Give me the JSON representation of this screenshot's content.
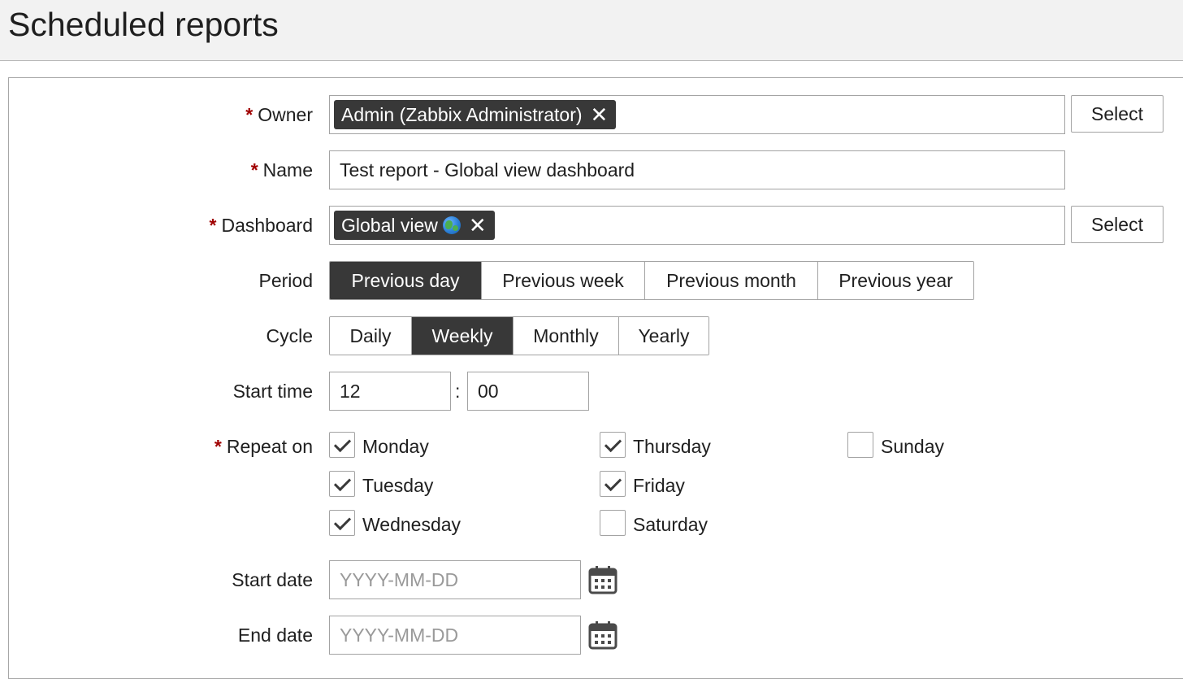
{
  "header": {
    "title": "Scheduled reports"
  },
  "form": {
    "owner": {
      "label": "Owner",
      "required": true,
      "tag": "Admin (Zabbix Administrator)",
      "remove": "✕",
      "button": "Select"
    },
    "name": {
      "label": "Name",
      "required": true,
      "value": "Test report - Global view dashboard"
    },
    "dashboard": {
      "label": "Dashboard",
      "required": true,
      "tag": "Global view",
      "remove": "✕",
      "button": "Select"
    },
    "period": {
      "label": "Period",
      "options": [
        "Previous day",
        "Previous week",
        "Previous month",
        "Previous year"
      ],
      "selected": "Previous day"
    },
    "cycle": {
      "label": "Cycle",
      "options": [
        "Daily",
        "Weekly",
        "Monthly",
        "Yearly"
      ],
      "selected": "Weekly"
    },
    "start_time": {
      "label": "Start time",
      "hours": "12",
      "separator": ":",
      "minutes": "00"
    },
    "repeat_on": {
      "label": "Repeat on",
      "required": true,
      "days": [
        {
          "name": "Monday",
          "checked": true
        },
        {
          "name": "Tuesday",
          "checked": true
        },
        {
          "name": "Wednesday",
          "checked": true
        },
        {
          "name": "Thursday",
          "checked": true
        },
        {
          "name": "Friday",
          "checked": true
        },
        {
          "name": "Saturday",
          "checked": false
        },
        {
          "name": "Sunday",
          "checked": false
        }
      ]
    },
    "start_date": {
      "label": "Start date",
      "value": "",
      "placeholder": "YYYY-MM-DD"
    },
    "end_date": {
      "label": "End date",
      "value": "",
      "placeholder": "YYYY-MM-DD"
    }
  },
  "required_marker": "*",
  "colors": {
    "required": "#a00000",
    "active_segment": "#383838",
    "border": "#a3a3a3"
  },
  "icons": {
    "remove": "close-icon",
    "globe": "globe-icon",
    "calendar": "calendar-icon",
    "check": "checkmark-icon"
  }
}
